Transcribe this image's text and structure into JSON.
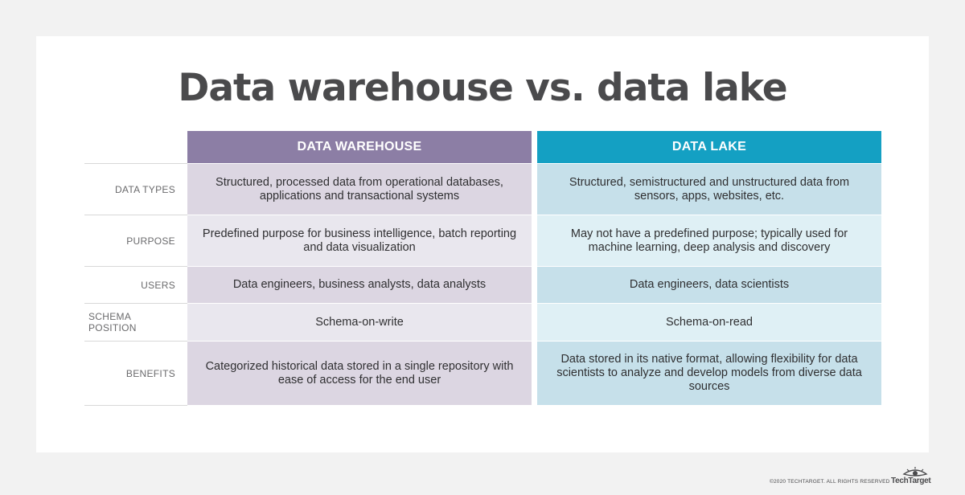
{
  "title": "Data warehouse vs. data lake",
  "columns": {
    "warehouse": "DATA WAREHOUSE",
    "lake": "DATA LAKE"
  },
  "rows": [
    {
      "label": "DATA TYPES",
      "warehouse": "Structured, processed data from operational databases, applications and transactional systems",
      "lake": "Structured, semistructured and unstructured data from sensors, apps, websites, etc."
    },
    {
      "label": "PURPOSE",
      "warehouse": "Predefined purpose for business intelligence, batch reporting and data visualization",
      "lake": "May not have a predefined purpose; typically used for machine learning, deep analysis and discovery"
    },
    {
      "label": "USERS",
      "warehouse": "Data engineers, business analysts, data analysts",
      "lake": "Data engineers, data scientists"
    },
    {
      "label": "SCHEMA POSITION",
      "warehouse": "Schema-on-write",
      "lake": "Schema-on-read"
    },
    {
      "label": "BENEFITS",
      "warehouse": "Categorized historical data stored in a single repository with ease of access for the end user",
      "lake": "Data stored in its native format, allowing flexibility for data scientists to analyze and develop models from diverse data sources"
    }
  ],
  "footer": {
    "copyright": "©2020 TECHTARGET. ALL RIGHTS RESERVED",
    "logo_text": "TechTarget",
    "logo_icon": "eye-icon"
  },
  "colors": {
    "warehouse_header": "#8c7ea5",
    "lake_header": "#14a0c3"
  }
}
